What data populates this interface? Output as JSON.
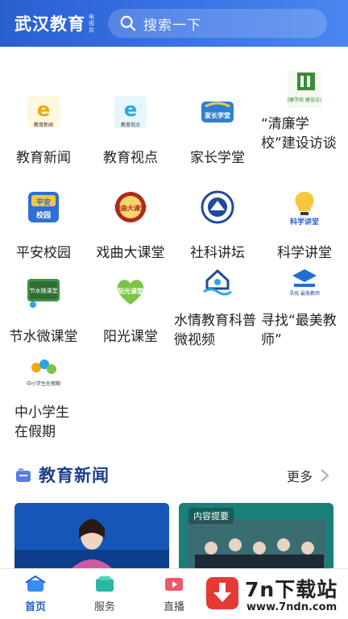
{
  "header": {
    "title": "武汉教育",
    "sub": "电视台",
    "search_placeholder": "搜索一下"
  },
  "grid": [
    {
      "label": "教育新闻",
      "icon": "edu-news-icon",
      "icon_text": "教育新闻"
    },
    {
      "label": "教育视点",
      "icon": "edu-view-icon",
      "icon_text": "教育视点"
    },
    {
      "label": "家长学堂",
      "icon": "parent-school-icon",
      "icon_text": "家长学堂"
    },
    {
      "label": "“清廉学校”建设访谈",
      "icon": "clean-school-icon",
      "icon_text": "清廉学校 建设访谈"
    },
    {
      "label": "平安校园",
      "icon": "safe-campus-icon",
      "icon_text": "平安校园"
    },
    {
      "label": "戏曲大课堂",
      "icon": "opera-class-icon",
      "icon_text": "戏曲大课堂"
    },
    {
      "label": "社科讲坛",
      "icon": "social-science-icon",
      "icon_text": ""
    },
    {
      "label": "科学讲堂",
      "icon": "science-lecture-icon",
      "icon_text": "科学讲堂"
    },
    {
      "label": "节水微课堂",
      "icon": "water-saving-icon",
      "icon_text": "节水微课堂"
    },
    {
      "label": "阳光课堂",
      "icon": "sunshine-class-icon",
      "icon_text": "阳光课堂"
    },
    {
      "label": "水情教育科普微视频",
      "icon": "water-education-icon",
      "icon_text": ""
    },
    {
      "label": "寻找“最美教师”",
      "icon": "best-teacher-icon",
      "icon_text": "寻找 最美教师"
    },
    {
      "label": "中小学生在假期",
      "icon": "student-holiday-icon",
      "icon_text": "中小学生在假期"
    }
  ],
  "section": {
    "title": "教育新闻",
    "more": "更多",
    "right_badge": "内容提要"
  },
  "tabs": [
    {
      "label": "首页",
      "active": true
    },
    {
      "label": "服务",
      "active": false
    },
    {
      "label": "直播",
      "active": false
    }
  ],
  "watermark": {
    "title": "7n下载站",
    "url": "www.7ndn.com"
  },
  "colors": {
    "accent": "#1f5fd1",
    "header": "#2a5fd0",
    "section_title": "#1f3f8a"
  }
}
